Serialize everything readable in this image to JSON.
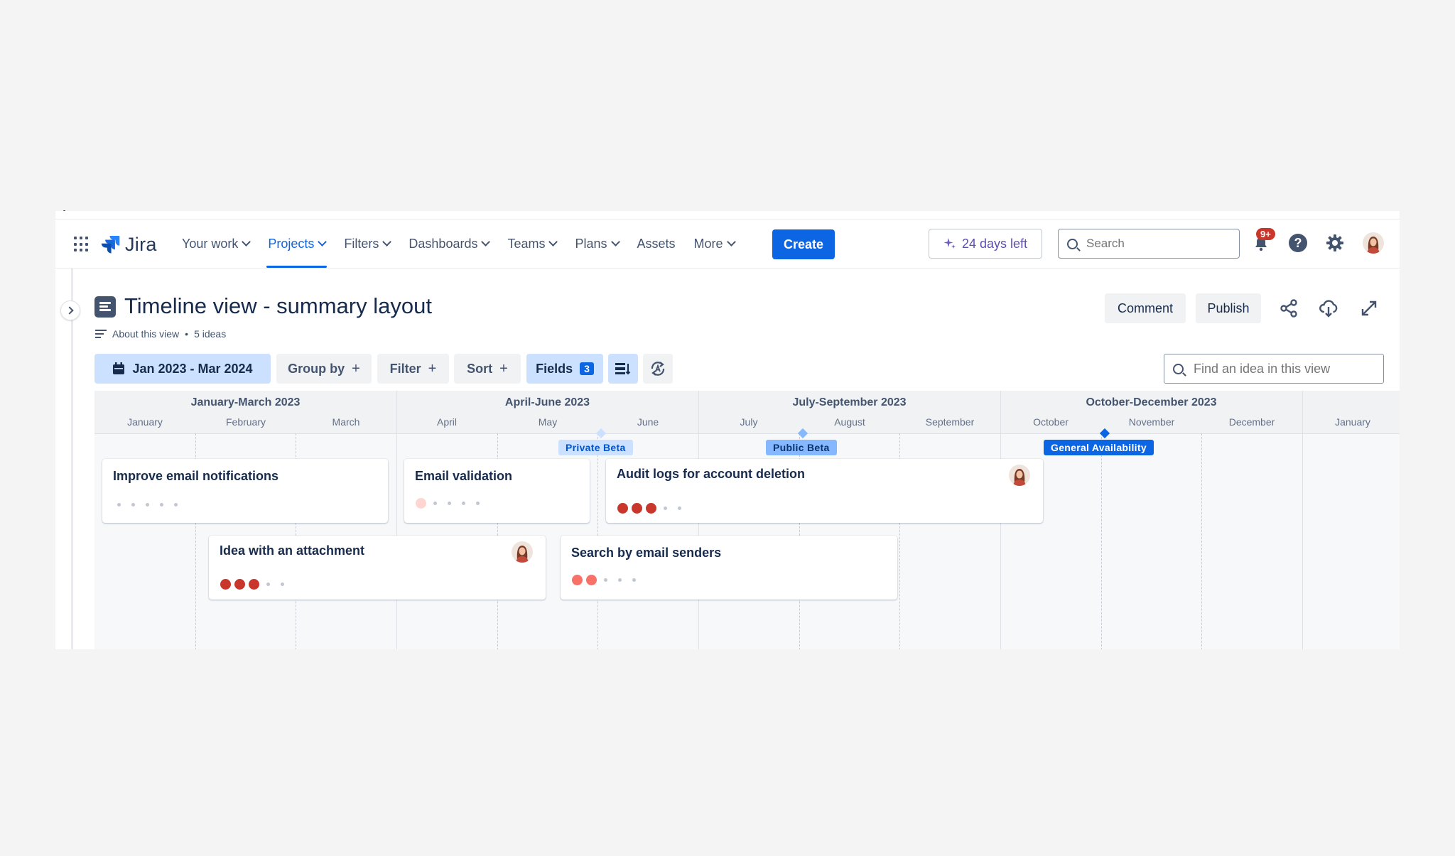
{
  "nav": {
    "product": "Jira",
    "items": [
      {
        "label": "Your work",
        "dropdown": true,
        "active": false
      },
      {
        "label": "Projects",
        "dropdown": true,
        "active": true
      },
      {
        "label": "Filters",
        "dropdown": true,
        "active": false
      },
      {
        "label": "Dashboards",
        "dropdown": true,
        "active": false
      },
      {
        "label": "Teams",
        "dropdown": true,
        "active": false
      },
      {
        "label": "Plans",
        "dropdown": true,
        "active": false
      },
      {
        "label": "Assets",
        "dropdown": false,
        "active": false
      },
      {
        "label": "More",
        "dropdown": true,
        "active": false
      }
    ],
    "create_label": "Create",
    "trial_label": "24 days left",
    "search_placeholder": "Search",
    "notifications_badge": "9+",
    "help_label": "?"
  },
  "header": {
    "title": "Timeline view - summary layout",
    "about": "About this view",
    "separator": "•",
    "ideas_count": "5 ideas",
    "comment_label": "Comment",
    "publish_label": "Publish"
  },
  "toolbar": {
    "date_range": "Jan 2023 - Mar 2024",
    "group_by": "Group by",
    "filter": "Filter",
    "sort": "Sort",
    "fields": "Fields",
    "fields_count": "3",
    "plus": "+",
    "find_placeholder": "Find an idea in this view"
  },
  "timeline": {
    "quarters": [
      "January-March 2023",
      "April-June 2023",
      "July-September 2023",
      "October-December 2023"
    ],
    "months": [
      "January",
      "February",
      "March",
      "April",
      "May",
      "June",
      "July",
      "August",
      "September",
      "October",
      "November",
      "December",
      "January"
    ],
    "milestones": [
      {
        "label": "Private Beta",
        "color": "#cce0ff",
        "text_color": "#0055cc"
      },
      {
        "label": "Public Beta",
        "color": "#85b8ff",
        "text_color": "#09326c"
      },
      {
        "label": "General Availability",
        "color": "#0c66e4",
        "text_color": "#ffffff"
      }
    ],
    "ideas": [
      {
        "title": "Improve email notifications",
        "rating": 0
      },
      {
        "title": "Email validation",
        "rating": 1
      },
      {
        "title": "Audit logs for account deletion",
        "rating": 3
      },
      {
        "title": "Idea with an attachment",
        "rating": 3
      },
      {
        "title": "Search by email senders",
        "rating": 2
      }
    ]
  },
  "colors": {
    "brand": "#0c66e4",
    "rating_strong": "#c9372c",
    "rating_medium": "#f87168",
    "rating_light": "#ffd5d2",
    "notification": "#c9372c"
  }
}
